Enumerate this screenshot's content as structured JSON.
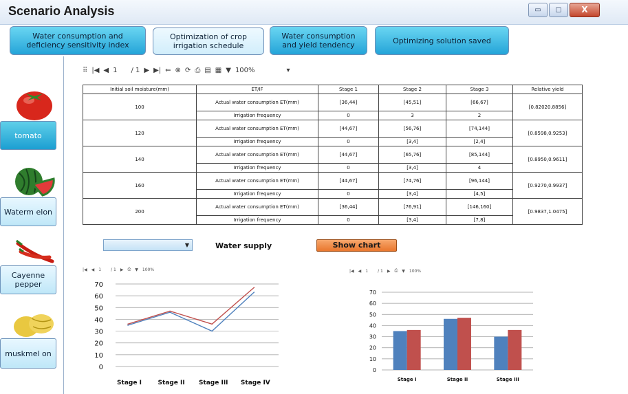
{
  "window": {
    "title": "Scenario Analysis",
    "min": "▭",
    "max": "▢",
    "close": "X"
  },
  "tabs": [
    {
      "label": "Water consumption and deficiency sensitivity index",
      "state": "active"
    },
    {
      "label": "Optimization of crop irrigation schedule",
      "state": "inactive"
    },
    {
      "label": "Water consumption and yield tendency",
      "state": "active"
    },
    {
      "label": "Optimizing solution saved",
      "state": "active"
    }
  ],
  "crops": [
    {
      "label": "tomato",
      "selected": true,
      "icon": "tomato-icon"
    },
    {
      "label": "Waterm elon",
      "selected": false,
      "icon": "watermelon-icon"
    },
    {
      "label": "Cayenne pepper",
      "selected": false,
      "icon": "pepper-icon"
    },
    {
      "label": "muskmel on",
      "selected": false,
      "icon": "muskmelon-icon"
    }
  ],
  "report_toolbar": {
    "page": "1",
    "of": "/ 1",
    "zoom": "100%"
  },
  "table": {
    "headers": [
      "Initial soil moisture(mm)",
      "ET/IF",
      "Stage 1",
      "Stage 2",
      "Stage 3",
      "Relative yield"
    ],
    "groups": [
      {
        "moisture": "100",
        "et": [
          "[36,44]",
          "[45,51]",
          "[66,67]"
        ],
        "freq": [
          "0",
          "3",
          "2"
        ],
        "yield": "[0.82020.8856]"
      },
      {
        "moisture": "120",
        "et": [
          "[44,67]",
          "[56,76]",
          "[74,144]"
        ],
        "freq": [
          "0",
          "[3,4]",
          "[2,4]"
        ],
        "yield": "[0.8598,0.9253]"
      },
      {
        "moisture": "140",
        "et": [
          "[44,67]",
          "[65,76]",
          "[85,144]"
        ],
        "freq": [
          "0",
          "[3,4]",
          "4"
        ],
        "yield": "[0.8950,0.9611]"
      },
      {
        "moisture": "160",
        "et": [
          "[44,67]",
          "[74,76]",
          "[96,144]"
        ],
        "freq": [
          "0",
          "[3,4]",
          "[4,5]"
        ],
        "yield": "[0.9270,0.9937]"
      },
      {
        "moisture": "200",
        "et": [
          "[36,44]",
          "[76,91]",
          "[146,160]"
        ],
        "freq": [
          "0",
          "[3,4]",
          "[7,8]"
        ],
        "yield": "[0.9837,1.0475]"
      }
    ],
    "et_label": "Actual water consumption ET(mm)",
    "freq_label": "Irrigation frequency"
  },
  "controls": {
    "water_supply_label": "Water supply",
    "show_chart_label": "Show chart",
    "dropdown_value": ""
  },
  "chart_toolbar": {
    "page": "1",
    "of": "/ 1",
    "zoom": "100%"
  },
  "colors": {
    "series1": "#4f81bd",
    "series2": "#c0504d",
    "accent": "#1c9fd2"
  },
  "chart_data": [
    {
      "type": "line",
      "categories": [
        "Stage I",
        "Stage II",
        "Stage III",
        "Stage IV"
      ],
      "series": [
        {
          "values": [
            35,
            46,
            30,
            63
          ]
        },
        {
          "values": [
            36,
            47,
            36,
            67
          ]
        }
      ],
      "ylim": [
        0,
        70
      ],
      "yticks": [
        0,
        10,
        20,
        30,
        40,
        50,
        60,
        70
      ],
      "grid": true
    },
    {
      "type": "bar",
      "categories": [
        "Stage I",
        "Stage II",
        "Stage III"
      ],
      "series": [
        {
          "values": [
            35,
            46,
            30
          ]
        },
        {
          "values": [
            36,
            47,
            36
          ]
        }
      ],
      "ylim": [
        0,
        70
      ],
      "yticks": [
        0,
        10,
        20,
        30,
        40,
        50,
        60,
        70
      ],
      "grid": true
    }
  ]
}
